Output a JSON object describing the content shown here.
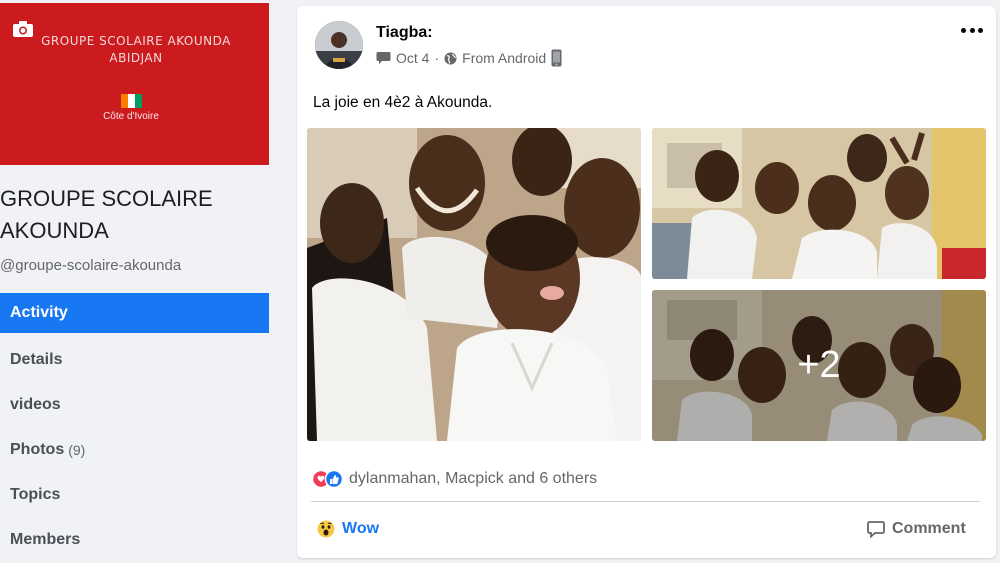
{
  "group": {
    "cover_org_line1": "GROUPE  SCOLAIRE AKOUNDA",
    "cover_org_line2": "ABIDJAN",
    "cover_country": "Côte d'Ivoire",
    "title": "GROUPE SCOLAIRE AKOUNDA",
    "handle": "@groupe-scolaire-akounda",
    "cover_color": "#cc1b1e",
    "flag_colors": [
      "#f77f00",
      "#ffffff",
      "#009e60"
    ]
  },
  "nav": {
    "items": [
      {
        "label": "Activity",
        "active": true
      },
      {
        "label": "Details"
      },
      {
        "label": "videos"
      },
      {
        "label": "Photos",
        "count": "(9)"
      },
      {
        "label": "Topics"
      },
      {
        "label": "Members"
      }
    ]
  },
  "post": {
    "author": "Tiagba:",
    "date": "Oct 4",
    "source": "From Android",
    "text": "La joie en 4è2 à Akounda.",
    "more_photos": "+2",
    "reactions_text": "dylanmahan, Macpick and 6 others",
    "wow_label": "Wow",
    "comment_label": "Comment"
  },
  "colors": {
    "accent": "#1877f2",
    "text_secondary": "#65676b"
  }
}
